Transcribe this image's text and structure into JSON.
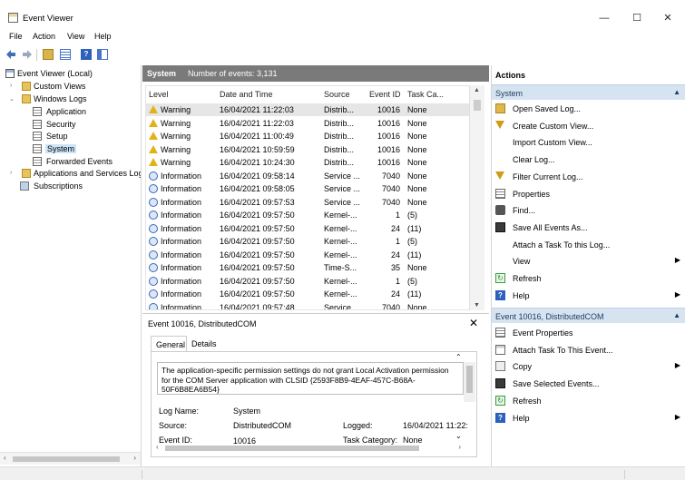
{
  "window": {
    "title": "Event Viewer",
    "minimize": "—",
    "maximize": "☐",
    "close": "✕"
  },
  "menu": [
    "File",
    "Action",
    "View",
    "Help"
  ],
  "tree": {
    "root": "Event Viewer (Local)",
    "custom_views": "Custom Views",
    "windows_logs": "Windows Logs",
    "logs": [
      "Application",
      "Security",
      "Setup",
      "System",
      "Forwarded Events"
    ],
    "apps_services": "Applications and Services Log",
    "subscriptions": "Subscriptions"
  },
  "center": {
    "log_name": "System",
    "count": "Number of events: 3,131",
    "columns": [
      "Level",
      "Date and Time",
      "Source",
      "Event ID",
      "Task Ca..."
    ],
    "rows": [
      {
        "level": "Warning",
        "date": "16/04/2021 11:22:03",
        "source": "Distrib...",
        "id": "10016",
        "task": "None"
      },
      {
        "level": "Warning",
        "date": "16/04/2021 11:22:03",
        "source": "Distrib...",
        "id": "10016",
        "task": "None"
      },
      {
        "level": "Warning",
        "date": "16/04/2021 11:00:49",
        "source": "Distrib...",
        "id": "10016",
        "task": "None"
      },
      {
        "level": "Warning",
        "date": "16/04/2021 10:59:59",
        "source": "Distrib...",
        "id": "10016",
        "task": "None"
      },
      {
        "level": "Warning",
        "date": "16/04/2021 10:24:30",
        "source": "Distrib...",
        "id": "10016",
        "task": "None"
      },
      {
        "level": "Information",
        "date": "16/04/2021 09:58:14",
        "source": "Service ...",
        "id": "7040",
        "task": "None"
      },
      {
        "level": "Information",
        "date": "16/04/2021 09:58:05",
        "source": "Service ...",
        "id": "7040",
        "task": "None"
      },
      {
        "level": "Information",
        "date": "16/04/2021 09:57:53",
        "source": "Service ...",
        "id": "7040",
        "task": "None"
      },
      {
        "level": "Information",
        "date": "16/04/2021 09:57:50",
        "source": "Kernel-...",
        "id": "1",
        "task": "(5)"
      },
      {
        "level": "Information",
        "date": "16/04/2021 09:57:50",
        "source": "Kernel-...",
        "id": "24",
        "task": "(11)"
      },
      {
        "level": "Information",
        "date": "16/04/2021 09:57:50",
        "source": "Kernel-...",
        "id": "1",
        "task": "(5)"
      },
      {
        "level": "Information",
        "date": "16/04/2021 09:57:50",
        "source": "Kernel-...",
        "id": "24",
        "task": "(11)"
      },
      {
        "level": "Information",
        "date": "16/04/2021 09:57:50",
        "source": "Time-S...",
        "id": "35",
        "task": "None"
      },
      {
        "level": "Information",
        "date": "16/04/2021 09:57:50",
        "source": "Kernel-...",
        "id": "1",
        "task": "(5)"
      },
      {
        "level": "Information",
        "date": "16/04/2021 09:57:50",
        "source": "Kernel-...",
        "id": "24",
        "task": "(11)"
      },
      {
        "level": "Information",
        "date": "16/04/2021 09:57:48",
        "source": "Service ...",
        "id": "7040",
        "task": "None"
      }
    ]
  },
  "detail": {
    "title": "Event 10016, DistributedCOM",
    "close": "✕",
    "tabs": [
      "General",
      "Details"
    ],
    "message": "The application-specific permission settings do not grant Local Activation permission for the COM Server application with CLSID {2593F8B9-4EAF-457C-B68A-50F6B8EA6B54}",
    "labels": {
      "log_name": "Log Name:",
      "source": "Source:",
      "event_id": "Event ID:",
      "logged": "Logged:",
      "task_category": "Task Category:"
    },
    "values": {
      "log_name": "System",
      "source": "DistributedCOM",
      "event_id": "10016",
      "logged": "16/04/2021 11:22:",
      "task_category": "None"
    }
  },
  "actions": {
    "title": "Actions",
    "system_section": "System",
    "system_items": [
      "Open Saved Log...",
      "Create Custom View...",
      "Import Custom View...",
      "Clear Log...",
      "Filter Current Log...",
      "Properties",
      "Find...",
      "Save All Events As...",
      "Attach a Task To this Log...",
      "View",
      "Refresh",
      "Help"
    ],
    "event_section": "Event 10016, DistributedCOM",
    "event_items": [
      "Event Properties",
      "Attach Task To This Event...",
      "Copy",
      "Save Selected Events...",
      "Refresh",
      "Help"
    ]
  }
}
